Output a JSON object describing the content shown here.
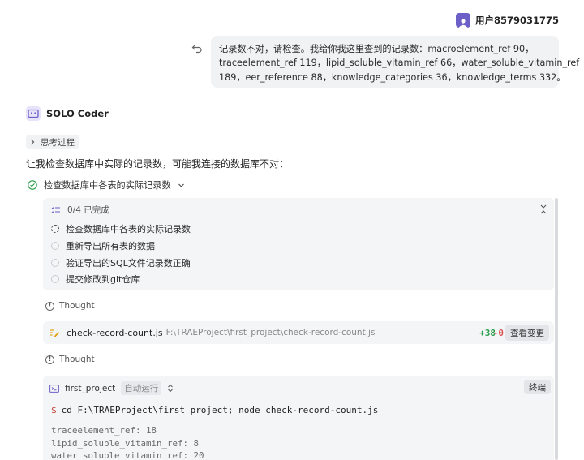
{
  "user": {
    "name": "用户8579031775"
  },
  "user_message": {
    "lines": [
      "记录数不对，请检查。我给你我这里查到的记录数：macroelement_ref 90，",
      "traceelement_ref 119，lipid_soluble_vitamin_ref 66，water_soluble_vitamin_ref",
      "189，eer_reference 88，knowledge_categories 36，knowledge_terms 332。"
    ]
  },
  "assistant": {
    "name": "SOLO Coder"
  },
  "thinking_label": "思考过程",
  "intro_text": "让我检查数据库中实际的记录数，可能我连接的数据库不对：",
  "task_title": "检查数据库中各表的实际记录数",
  "todo": {
    "progress": "0/4 已完成",
    "items": [
      "检查数据库中各表的实际记录数",
      "重新导出所有表的数据",
      "验证导出的SQL文件记录数正确",
      "提交修改到git仓库"
    ]
  },
  "thought_label": "Thought",
  "file_edit": {
    "name": "check-record-count.js",
    "path": "F:\\TRAEProject\\first_project\\check-record-count.js",
    "added": "+38",
    "removed": "-0",
    "view_label": "查看变更"
  },
  "terminal": {
    "name": "first_project",
    "mode": "自动运行",
    "stop_label": "终端",
    "prompt": "$",
    "command": "cd F:\\TRAEProject\\first_project; node check-record-count.js",
    "output": [
      "traceelement_ref: 18",
      "lipid_soluble_vitamin_ref: 8",
      "water_soluble_vitamin_ref: 20"
    ]
  },
  "colors": {
    "accent": "#6c5fc7",
    "added": "#2a9d4b",
    "removed": "#d9534f",
    "success": "#2a9d4b"
  }
}
